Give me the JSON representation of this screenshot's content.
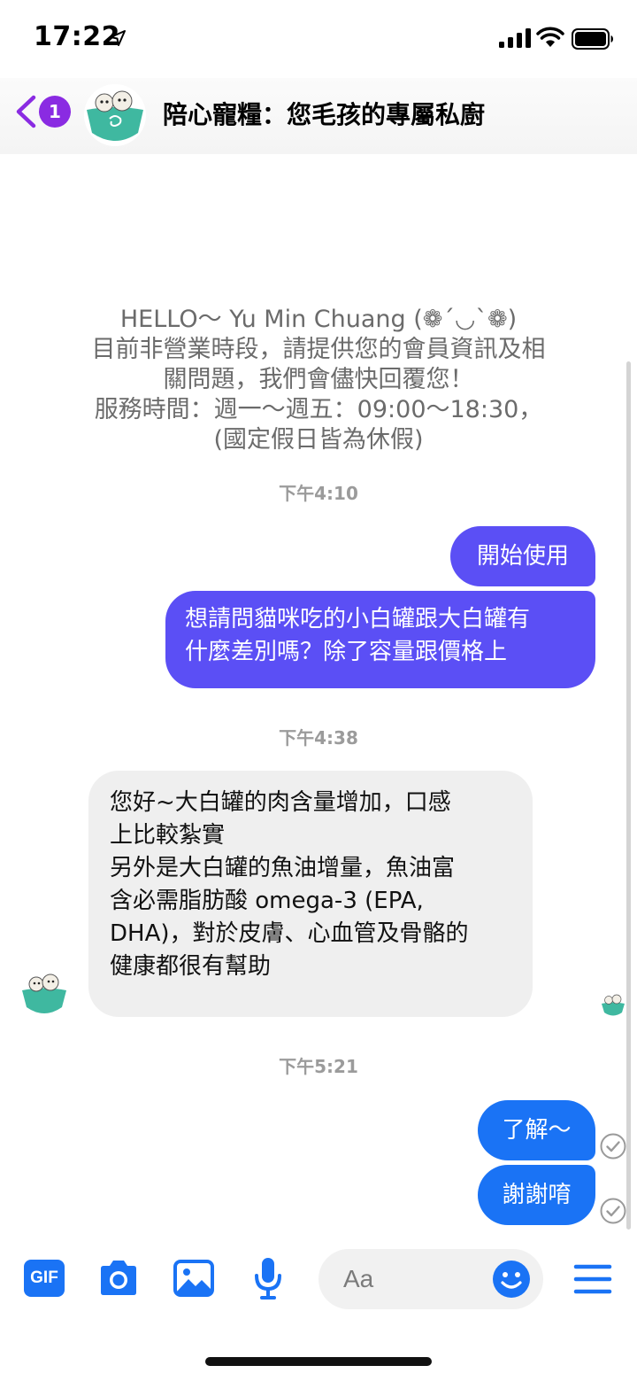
{
  "status_bar": {
    "time": "17:22"
  },
  "header": {
    "unread_count": "1",
    "title": "陪心寵糧：您毛孩的專屬私廚"
  },
  "messages": {
    "system_lines": [
      "HELLO～ Yu Min Chuang (❁´◡`❁)",
      "目前非營業時段，請提供您的會員資訊及相",
      "關問題，我們會儘快回覆您！",
      "服務時間：週一～週五：09:00～18:30，",
      "(國定假日皆為休假)"
    ],
    "ts1": "下午4:10",
    "sent1": "開始使用",
    "sent2_lines": [
      "想請問貓咪吃的小白罐跟大白罐有",
      "什麼差別嗎？除了容量跟價格上"
    ],
    "ts2": "下午4:38",
    "recv1_lines": [
      "您好~大白罐的肉含量增加，口感",
      "上比較紮實",
      "另外是大白罐的魚油增量，魚油富",
      "含必需脂肪酸 omega-3 (EPA,",
      "DHA)，對於皮膚、心血管及骨骼的",
      "健康都很有幫助"
    ],
    "ts3": "下午5:21",
    "sent3": "了解～",
    "sent4": "謝謝唷"
  },
  "composer": {
    "placeholder": "Aa"
  },
  "icons": {
    "gif": "GIF"
  },
  "colors": {
    "accent_purple": "#5b4ff5",
    "accent_blue": "#1a73f5",
    "badge_purple": "#8a2be2",
    "received_bubble": "#efefef"
  }
}
